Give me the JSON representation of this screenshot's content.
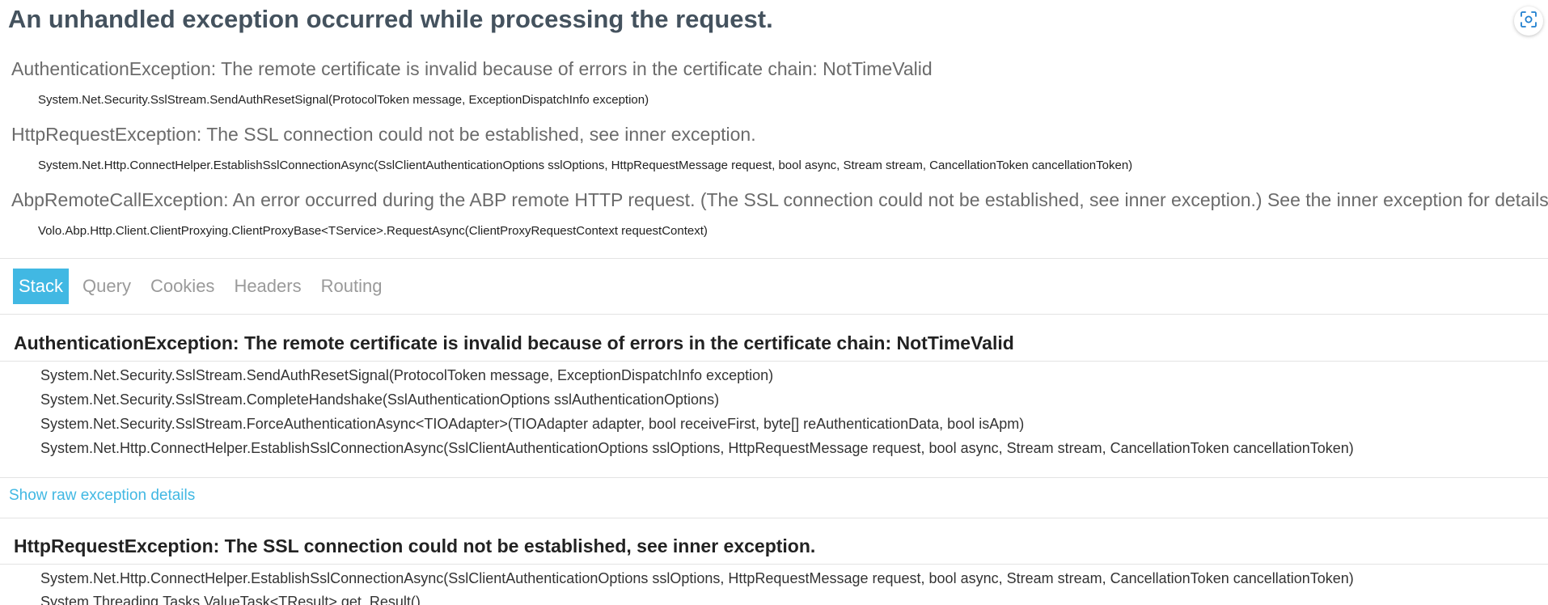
{
  "page_title": "An unhandled exception occurred while processing the request.",
  "toolbar": {
    "screenshot_icon": "screenshot-capture-icon"
  },
  "summary": [
    {
      "title": "AuthenticationException: The remote certificate is invalid because of errors in the certificate chain: NotTimeValid",
      "frame": "System.Net.Security.SslStream.SendAuthResetSignal(ProtocolToken message, ExceptionDispatchInfo exception)"
    },
    {
      "title": "HttpRequestException: The SSL connection could not be established, see inner exception.",
      "frame": "System.Net.Http.ConnectHelper.EstablishSslConnectionAsync(SslClientAuthenticationOptions sslOptions, HttpRequestMessage request, bool async, Stream stream, CancellationToken cancellationToken)"
    },
    {
      "title": "AbpRemoteCallException: An error occurred during the ABP remote HTTP request. (The SSL connection could not be established, see inner exception.) See the inner exception for details.",
      "frame": "Volo.Abp.Http.Client.ClientProxying.ClientProxyBase<TService>.RequestAsync(ClientProxyRequestContext requestContext)"
    }
  ],
  "tabs": [
    "Stack",
    "Query",
    "Cookies",
    "Headers",
    "Routing"
  ],
  "active_tab": "Stack",
  "stack": [
    {
      "title": "AuthenticationException: The remote certificate is invalid because of errors in the certificate chain: NotTimeValid",
      "frames": [
        "System.Net.Security.SslStream.SendAuthResetSignal(ProtocolToken message, ExceptionDispatchInfo exception)",
        "System.Net.Security.SslStream.CompleteHandshake(SslAuthenticationOptions sslAuthenticationOptions)",
        "System.Net.Security.SslStream.ForceAuthenticationAsync<TIOAdapter>(TIOAdapter adapter, bool receiveFirst, byte[] reAuthenticationData, bool isApm)",
        "System.Net.Http.ConnectHelper.EstablishSslConnectionAsync(SslClientAuthenticationOptions sslOptions, HttpRequestMessage request, bool async, Stream stream, CancellationToken cancellationToken)"
      ],
      "raw_link": "Show raw exception details"
    },
    {
      "title": "HttpRequestException: The SSL connection could not be established, see inner exception.",
      "frames": [
        "System.Net.Http.ConnectHelper.EstablishSslConnectionAsync(SslClientAuthenticationOptions sslOptions, HttpRequestMessage request, bool async, Stream stream, CancellationToken cancellationToken)",
        "System.Threading.Tasks.ValueTask<TResult>.get_Result()"
      ]
    }
  ]
}
